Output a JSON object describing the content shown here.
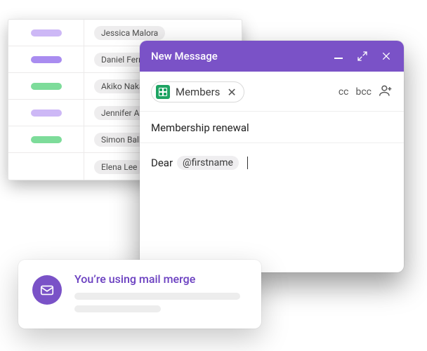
{
  "table": {
    "rows": [
      {
        "pill_color": "pill-lavender",
        "name": "Jessica Malora"
      },
      {
        "pill_color": "pill-purple",
        "name": "Daniel Ferr"
      },
      {
        "pill_color": "pill-green",
        "name": "Akiko Naka"
      },
      {
        "pill_color": "pill-lavender",
        "name": "Jennifer Ac"
      },
      {
        "pill_color": "pill-green",
        "name": "Simon Balli"
      },
      {
        "pill_color": "",
        "name": "Elena Lee"
      }
    ]
  },
  "compose": {
    "title": "New Message",
    "recipient_chip": "Members",
    "cc": "cc",
    "bcc": "bcc",
    "subject": "Membership renewal",
    "body_prefix": "Dear",
    "merge_tag": "@firstname"
  },
  "toast": {
    "title": "You’re using mail merge"
  }
}
